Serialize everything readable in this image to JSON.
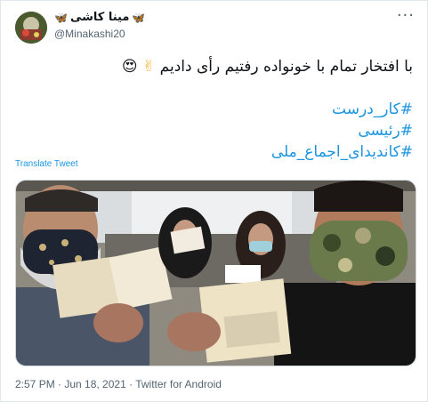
{
  "tweet": {
    "display_name": "مینا کاشی",
    "name_decoration_icon": "butterfly-icon",
    "handle": "@Minakashi20",
    "text": "با افتخار تمام با خونواده رفتیم رأی دادیم",
    "text_emoji_1": "✌",
    "text_emoji_2": "😍",
    "hashtags": [
      "#کار_درست",
      "#رئیسی",
      "#کاندیدای_اجماع_ملی"
    ],
    "translate_label": "Translate Tweet",
    "timestamp": "2:57 PM · Jun 18, 2021 · Twitter for Android",
    "more_label": "···"
  },
  "colors": {
    "link": "#1b95e0",
    "secondary_text": "#536471",
    "border": "#e1e8ed"
  }
}
